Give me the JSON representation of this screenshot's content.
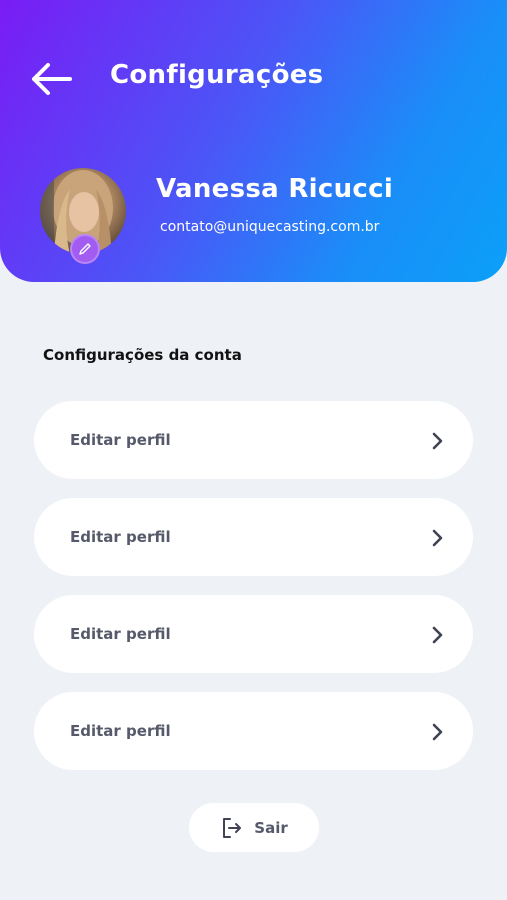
{
  "header": {
    "title": "Configurações",
    "back_icon": "arrow-left-icon"
  },
  "profile": {
    "name": "Vanessa Ricucci",
    "email": "contato@uniquecasting.com.br",
    "edit_icon": "pencil-icon"
  },
  "account": {
    "section_title": "Configurações da conta",
    "items": [
      {
        "label": "Editar perfil",
        "icon": "chevron-right-icon"
      },
      {
        "label": "Editar perfil",
        "icon": "chevron-right-icon"
      },
      {
        "label": "Editar perfil",
        "icon": "chevron-right-icon"
      },
      {
        "label": "Editar perfil",
        "icon": "chevron-right-icon"
      }
    ]
  },
  "logout": {
    "label": "Sair",
    "icon": "logout-icon"
  },
  "colors": {
    "gradient_start": "#7a1cf5",
    "gradient_end": "#0aa0f8",
    "background": "#eef2f6",
    "accent_badge": "#a35cf2",
    "label_text": "#55596a"
  }
}
